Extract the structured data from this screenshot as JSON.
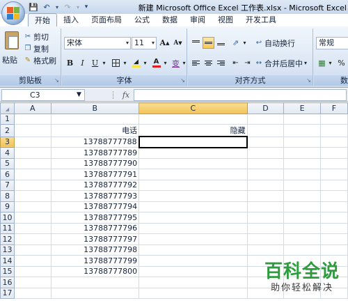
{
  "window": {
    "title": "新建 Microsoft Office Excel 工作表.xlsx - Microsoft Excel"
  },
  "tabs": [
    "开始",
    "插入",
    "页面布局",
    "公式",
    "数据",
    "审阅",
    "视图",
    "开发工具"
  ],
  "ribbon": {
    "clipboard": {
      "paste_label": "粘贴",
      "cut_label": "剪切",
      "copy_label": "复制",
      "format_painter_label": "格式刷",
      "group_label": "剪贴板"
    },
    "font": {
      "font_name": "宋体",
      "font_size": "11",
      "bold_label": "B",
      "italic_label": "I",
      "underline_label": "U",
      "font_color_label": "A",
      "phonetic_label": "变",
      "grow_label": "A",
      "shrink_label": "A",
      "group_label": "字体"
    },
    "alignment": {
      "wrap_label": "自动换行",
      "merge_label": "合并后居中",
      "group_label": "对齐方式"
    },
    "number": {
      "format_value": "常规",
      "percent_label": "%",
      "group_label": "数"
    }
  },
  "formula_bar": {
    "name_box": "C3",
    "fx_label": "fx",
    "formula": ""
  },
  "sheet": {
    "columns": [
      "A",
      "B",
      "C",
      "D",
      "E",
      "F"
    ],
    "rows": [
      {
        "row": "1",
        "B": "",
        "C": ""
      },
      {
        "row": "2",
        "B": "电话",
        "C": "隐藏"
      },
      {
        "row": "3",
        "B": "13788777788",
        "C": ""
      },
      {
        "row": "4",
        "B": "13788777789",
        "C": ""
      },
      {
        "row": "5",
        "B": "13788777790",
        "C": ""
      },
      {
        "row": "6",
        "B": "13788777791",
        "C": ""
      },
      {
        "row": "7",
        "B": "13788777792",
        "C": ""
      },
      {
        "row": "8",
        "B": "13788777793",
        "C": ""
      },
      {
        "row": "9",
        "B": "13788777794",
        "C": ""
      },
      {
        "row": "10",
        "B": "13788777795",
        "C": ""
      },
      {
        "row": "11",
        "B": "13788777796",
        "C": ""
      },
      {
        "row": "12",
        "B": "13788777797",
        "C": ""
      },
      {
        "row": "13",
        "B": "13788777798",
        "C": ""
      },
      {
        "row": "14",
        "B": "13788777799",
        "C": ""
      },
      {
        "row": "15",
        "B": "13788777800",
        "C": ""
      },
      {
        "row": "16",
        "B": "",
        "C": ""
      },
      {
        "row": "17",
        "B": "",
        "C": ""
      }
    ],
    "selected_column": "C",
    "selected_row": "3"
  },
  "watermark": {
    "main": "百科全说",
    "sub": "助你轻松解决"
  },
  "colors": {
    "selection_highlight": "#f2c35b",
    "watermark_green": "#2c9c3d",
    "font_color_bar": "#e02020",
    "fill_color_bar": "#f7e53c"
  }
}
